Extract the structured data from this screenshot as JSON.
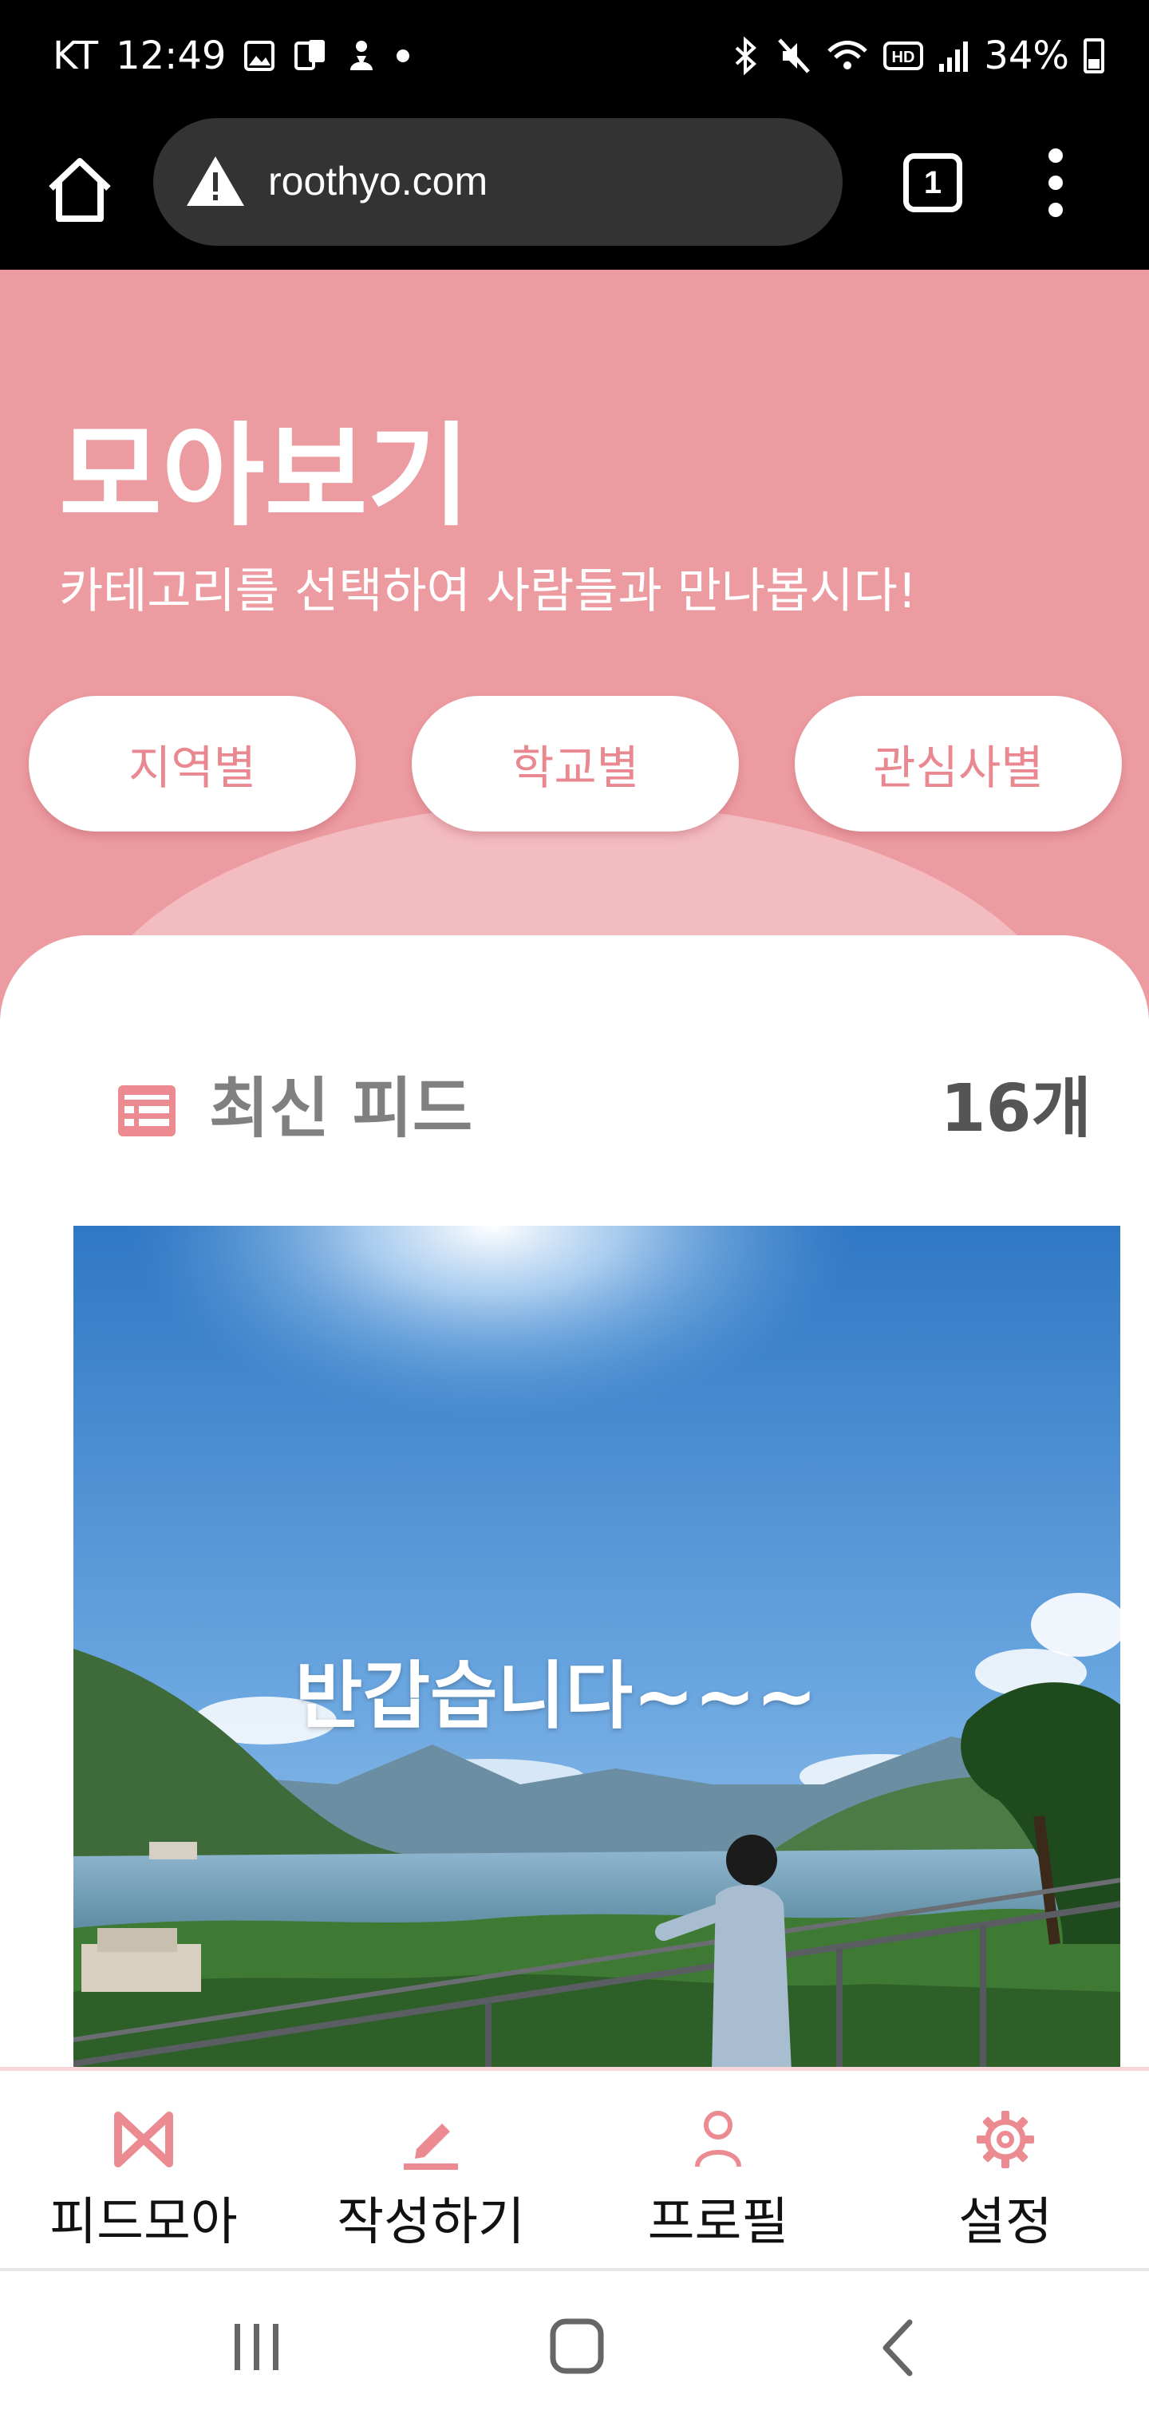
{
  "status_bar": {
    "carrier": "KT",
    "time": "12:49",
    "battery": "34%",
    "left_icons": [
      "gallery-icon",
      "screen-icon",
      "app-icon",
      "dot-icon"
    ],
    "right_icons": [
      "bluetooth-icon",
      "mute-icon",
      "wifi-icon",
      "hd-icon",
      "signal-icon",
      "battery-icon"
    ]
  },
  "browser": {
    "url": "roothyo.com",
    "tab_count": "1"
  },
  "hero": {
    "title": "모아보기",
    "subtitle": "카테고리를 선택하여 사람들과 만나봅시다!",
    "categories": [
      {
        "label": "지역별"
      },
      {
        "label": "학교별"
      },
      {
        "label": "관심사별"
      }
    ],
    "colors": {
      "background": "#ec9ba0",
      "arc": "#f3bcc0",
      "button_text": "#e98890"
    }
  },
  "feed": {
    "title": "최신 피드",
    "count": "16개",
    "post": {
      "caption": "반갑습니다~~~"
    }
  },
  "bottom_nav": {
    "items": [
      {
        "label": "피드모아",
        "icon": "bowtie-icon"
      },
      {
        "label": "작성하기",
        "icon": "pencil-icon"
      },
      {
        "label": "프로필",
        "icon": "person-icon"
      },
      {
        "label": "설정",
        "icon": "gear-icon"
      }
    ],
    "accent": "#ec8a92"
  },
  "android_nav": {
    "buttons": [
      "recent-apps-icon",
      "home-icon",
      "back-icon"
    ]
  }
}
